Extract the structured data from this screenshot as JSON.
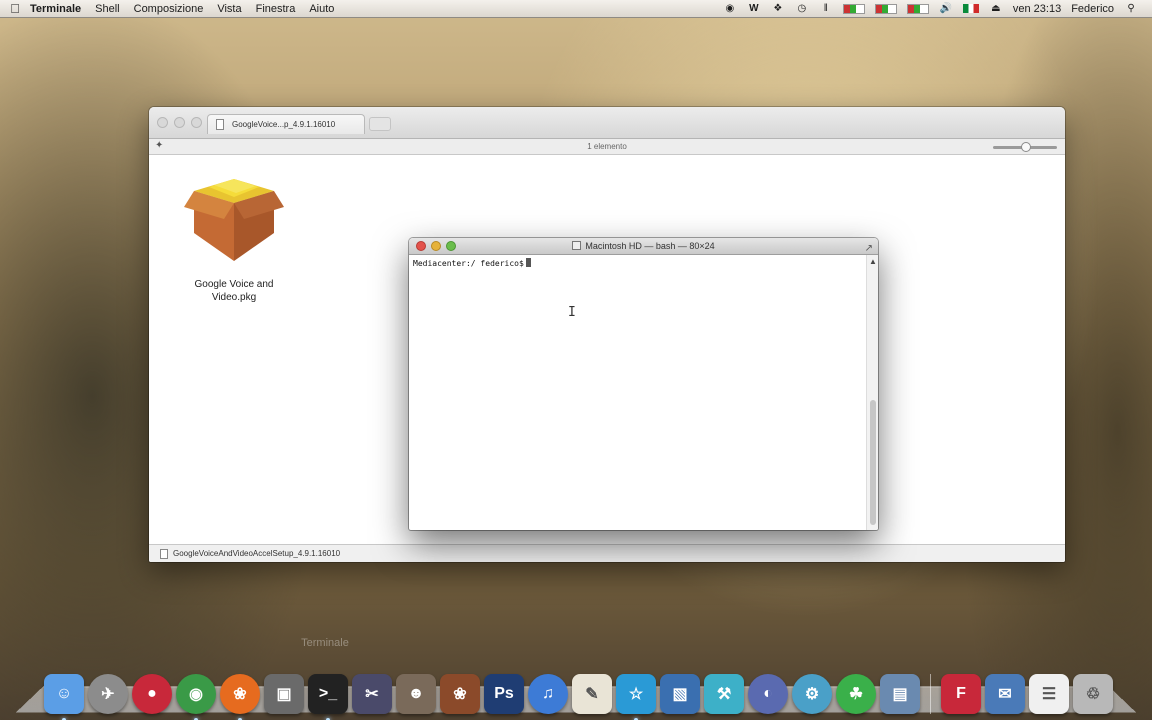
{
  "menubar": {
    "app_name": "Terminale",
    "menus": [
      "Shell",
      "Composizione",
      "Vista",
      "Finestra",
      "Aiuto"
    ],
    "clock": "ven 23:13",
    "user": "Federico"
  },
  "finder": {
    "tab_title": "GoogleVoice...p_4.9.1.16010",
    "item_count": "1 elemento",
    "file_label": "Google Voice and Video.pkg",
    "path": "GoogleVoiceAndVideoAccelSetup_4.9.1.16010"
  },
  "terminal": {
    "title": "Macintosh HD — bash — 80×24",
    "prompt": "Mediacenter:/ federico$"
  },
  "dock": {
    "hover_label": "Terminale",
    "items": [
      {
        "name": "finder-icon",
        "color": "#5b9ee6"
      },
      {
        "name": "launchpad-icon",
        "color": "#8c8c8c"
      },
      {
        "name": "colorful-ball-icon",
        "color": "#c8283a"
      },
      {
        "name": "chrome-icon",
        "color": "#3a9a47"
      },
      {
        "name": "firefox-icon",
        "color": "#e66b1f"
      },
      {
        "name": "photo-booth-icon",
        "color": "#6a6a6a"
      },
      {
        "name": "terminal-icon",
        "color": "#222222"
      },
      {
        "name": "final-cut-icon",
        "color": "#4a4a6a"
      },
      {
        "name": "disguise-icon",
        "color": "#7a6a5a"
      },
      {
        "name": "fruit-icon",
        "color": "#8b4a2a"
      },
      {
        "name": "photoshop-icon",
        "color": "#1f3d73"
      },
      {
        "name": "itunes-icon",
        "color": "#3d7bd6"
      },
      {
        "name": "textedit-icon",
        "color": "#e9e4d6"
      },
      {
        "name": "fetch-icon",
        "color": "#2a9ad6"
      },
      {
        "name": "vmware-icon",
        "color": "#3a6fb0"
      },
      {
        "name": "xcode-icon",
        "color": "#3db0c8"
      },
      {
        "name": "planet-icon",
        "color": "#5a6ab0"
      },
      {
        "name": "scanner-icon",
        "color": "#4aa0c8"
      },
      {
        "name": "green-leaf-icon",
        "color": "#3ab04a"
      },
      {
        "name": "preview-icon",
        "color": "#6a8ab0"
      },
      {
        "name": "filezilla-icon",
        "color": "#c8283a"
      },
      {
        "name": "mail-icon",
        "color": "#4a7ab8"
      },
      {
        "name": "document-icon",
        "color": "#f0f0f0"
      },
      {
        "name": "trash-icon",
        "color": "#b8b8b8"
      }
    ]
  }
}
